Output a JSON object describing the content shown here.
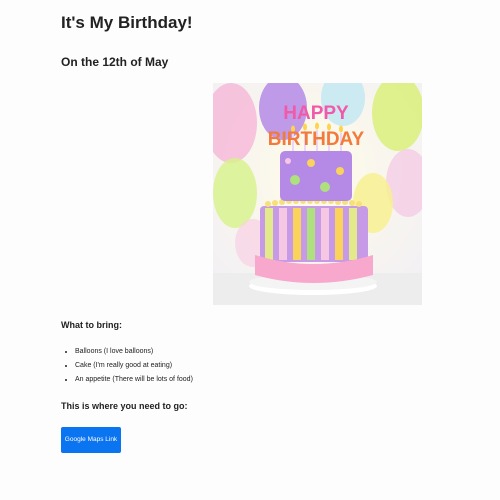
{
  "header": {
    "title": "It's My Birthday!",
    "subtitle": "On the 12th of May"
  },
  "photo": {
    "cake_text_top": "HAPPY",
    "cake_text_bottom": "BIRTHDAY"
  },
  "bring": {
    "heading": "What to bring:",
    "items": [
      "Balloons (I love balloons)",
      "Cake (I'm really good at eating)",
      "An appetite (There will be lots of food)"
    ]
  },
  "directions": {
    "heading": "This is where you need to go:",
    "button_label": "Google Maps Link"
  },
  "colors": {
    "button_bg": "#0b74f0",
    "button_text": "#ffffff"
  }
}
